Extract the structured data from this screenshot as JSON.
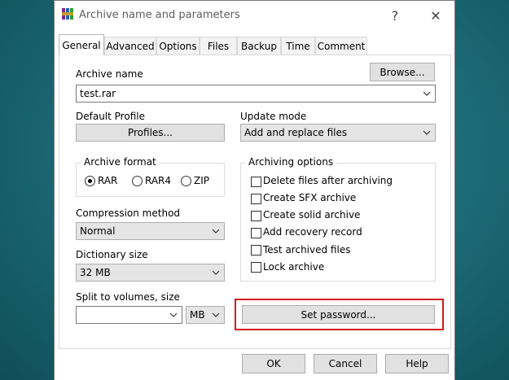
{
  "window": {
    "title": "Archive name and parameters",
    "help_glyph": "?",
    "close_glyph": "✕"
  },
  "tabs": [
    {
      "label": "General",
      "active": true
    },
    {
      "label": "Advanced"
    },
    {
      "label": "Options"
    },
    {
      "label": "Files"
    },
    {
      "label": "Backup"
    },
    {
      "label": "Time"
    },
    {
      "label": "Comment"
    }
  ],
  "general": {
    "archive_name_label": "Archive name",
    "browse_label": "Browse...",
    "archive_name_value": "test.rar",
    "default_profile_label": "Default Profile",
    "profiles_label": "Profiles...",
    "update_mode_label": "Update mode",
    "update_mode_value": "Add and replace files",
    "archive_format": {
      "title": "Archive format",
      "options": [
        "RAR",
        "RAR4",
        "ZIP"
      ],
      "selected": "RAR"
    },
    "compression_method_label": "Compression method",
    "compression_method_value": "Normal",
    "dictionary_size_label": "Dictionary size",
    "dictionary_size_value": "32 MB",
    "split_label": "Split to volumes, size",
    "split_value": "",
    "split_unit": "MB",
    "archiving_options": {
      "title": "Archiving options",
      "items": [
        "Delete files after archiving",
        "Create SFX archive",
        "Create solid archive",
        "Add recovery record",
        "Test archived files",
        "Lock archive"
      ]
    },
    "set_password_label": "Set password..."
  },
  "footer": {
    "ok_label": "OK",
    "cancel_label": "Cancel",
    "help_label": "Help"
  },
  "colors": {
    "highlight": "#d01c1c",
    "desktop": "#1d6d79"
  }
}
